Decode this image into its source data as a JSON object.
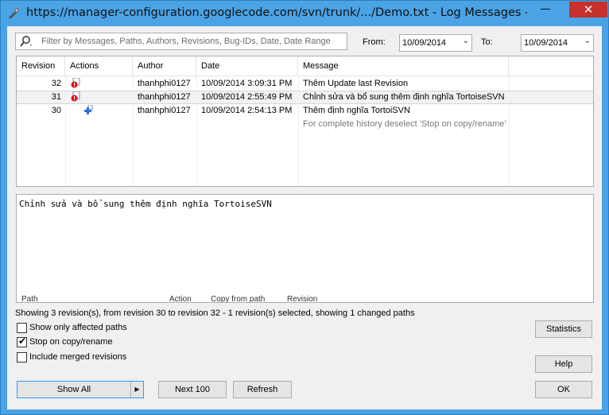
{
  "window": {
    "title": "https://manager-configuration.googlecode.com/svn/trunk/.../Demo.txt - Log Messages - Tort..."
  },
  "filter": {
    "placeholder": "Filter by Messages, Paths, Authors, Revisions, Bug-IDs, Date, Date Range",
    "from_label": "From:",
    "from_value": "10/09/2014",
    "to_label": "To:",
    "to_value": "10/09/2014"
  },
  "log": {
    "columns": [
      "Revision",
      "Actions",
      "Author",
      "Date",
      "Message"
    ],
    "rows": [
      {
        "revision": "32",
        "author": "thanhphi0127",
        "date": "10/09/2014 3:09:31 PM",
        "message": "Thêm Update last Revision"
      },
      {
        "revision": "31",
        "author": "thanhphi0127",
        "date": "10/09/2014 2:55:49 PM",
        "message": "Chỉnh sửa và bổ sung thêm định nghĩa TortoiseSVN"
      },
      {
        "revision": "30",
        "author": "thanhphi0127",
        "date": "10/09/2014 2:54:13 PM",
        "message": "Thêm định nghĩa TortoiSVN"
      }
    ],
    "hint": "For complete history deselect 'Stop on copy/rename'"
  },
  "message_text": "Chỉnh sửa và bổ sung thêm định nghĩa TortoiseSVN",
  "paths_columns": [
    "Path",
    "Action",
    "Copy from path",
    "Revision"
  ],
  "status": "Showing 3 revision(s), from revision 30 to revision 32 - 1 revision(s) selected, showing 1 changed paths",
  "options": {
    "affected": {
      "label": "Show only affected paths",
      "checked": false
    },
    "stop_copy": {
      "label": "Stop on copy/rename",
      "checked": true
    },
    "merged": {
      "label": "Include merged revisions",
      "checked": false
    }
  },
  "buttons": {
    "show_all": "Show All",
    "next_100": "Next 100",
    "refresh": "Refresh",
    "statistics": "Statistics",
    "help": "Help",
    "ok": "OK"
  },
  "icons": {
    "app": "tortoisesvn-icon",
    "search": "search-icon",
    "modified_action": "modified-icon",
    "added_action": "added-icon"
  },
  "colors": {
    "titlebar": "#4aa3e4",
    "close": "#c7302b",
    "hint_text": "#7a7a7a"
  }
}
